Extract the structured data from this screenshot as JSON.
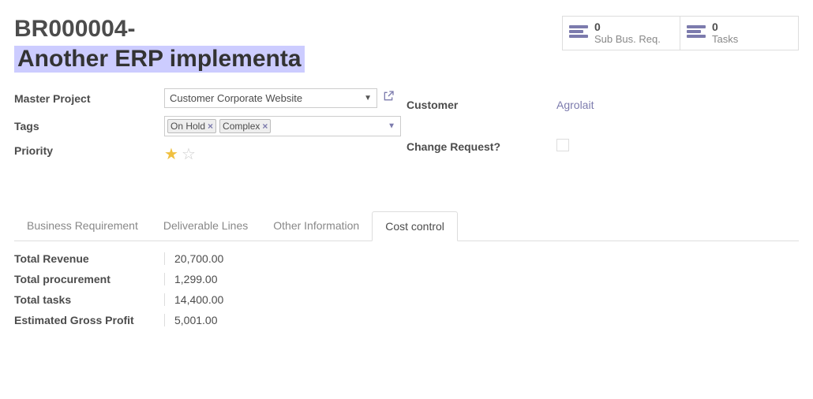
{
  "record": {
    "id_display": "BR000004-",
    "name": "Another ERP implementa"
  },
  "stats": {
    "sub_bus_req": {
      "count": "0",
      "label": "Sub Bus. Req."
    },
    "tasks": {
      "count": "0",
      "label": "Tasks"
    }
  },
  "form": {
    "labels": {
      "master_project": "Master Project",
      "tags": "Tags",
      "priority": "Priority",
      "customer": "Customer",
      "change_request": "Change Request?"
    },
    "master_project": "Customer Corporate Website",
    "tags": [
      "On Hold",
      "Complex"
    ],
    "customer": "Agrolait"
  },
  "tabs": [
    {
      "label": "Business Requirement",
      "active": false
    },
    {
      "label": "Deliverable Lines",
      "active": false
    },
    {
      "label": "Other Information",
      "active": false
    },
    {
      "label": "Cost control",
      "active": true
    }
  ],
  "cost_control": {
    "rows": [
      {
        "label": "Total Revenue",
        "value": "20,700.00"
      },
      {
        "label": "Total procurement",
        "value": "1,299.00"
      },
      {
        "label": "Total tasks",
        "value": "14,400.00"
      },
      {
        "label": "Estimated Gross Profit",
        "value": "5,001.00"
      }
    ]
  }
}
